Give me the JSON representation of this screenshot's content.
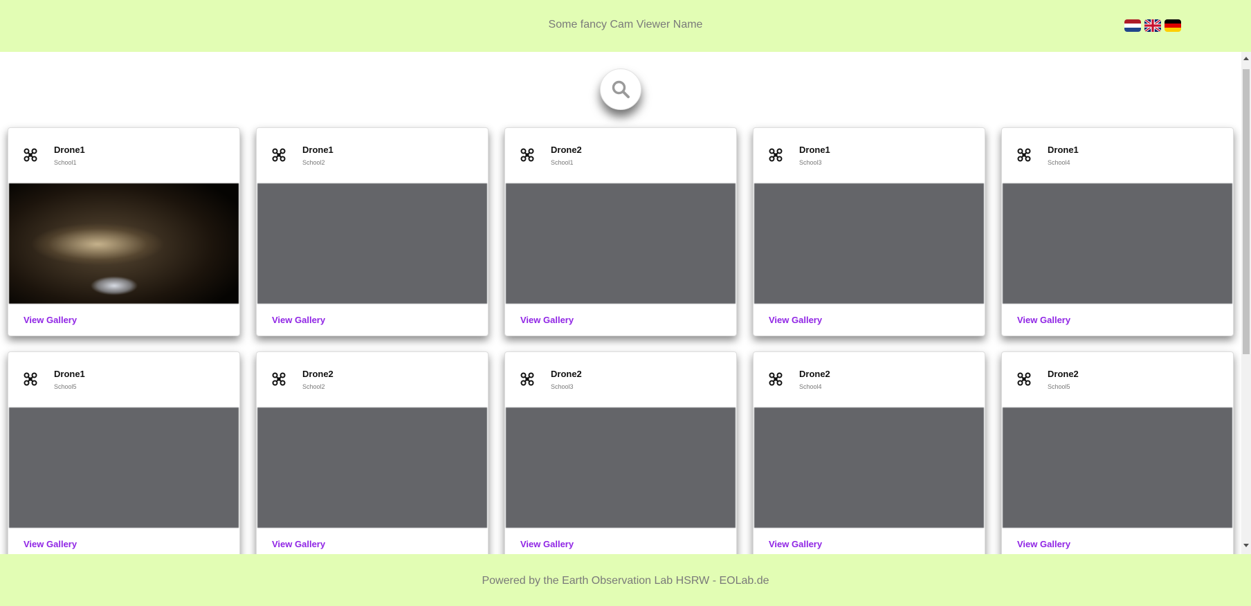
{
  "header": {
    "title": "Some fancy Cam Viewer Name",
    "flags": [
      {
        "icon": "netherlands-flag-icon"
      },
      {
        "icon": "uk-flag-icon"
      },
      {
        "icon": "germany-flag-icon"
      }
    ]
  },
  "search": {
    "icon": "search-icon"
  },
  "cards": [
    {
      "title": "Drone1",
      "subtitle": "School1",
      "link": "View Gallery",
      "has_image": true
    },
    {
      "title": "Drone1",
      "subtitle": "School2",
      "link": "View Gallery",
      "has_image": false
    },
    {
      "title": "Drone2",
      "subtitle": "School1",
      "link": "View Gallery",
      "has_image": false
    },
    {
      "title": "Drone1",
      "subtitle": "School3",
      "link": "View Gallery",
      "has_image": false
    },
    {
      "title": "Drone1",
      "subtitle": "School4",
      "link": "View Gallery",
      "has_image": false
    },
    {
      "title": "Drone1",
      "subtitle": "School5",
      "link": "View Gallery",
      "has_image": false
    },
    {
      "title": "Drone2",
      "subtitle": "School2",
      "link": "View Gallery",
      "has_image": false
    },
    {
      "title": "Drone2",
      "subtitle": "School3",
      "link": "View Gallery",
      "has_image": false
    },
    {
      "title": "Drone2",
      "subtitle": "School4",
      "link": "View Gallery",
      "has_image": false
    },
    {
      "title": "Drone2",
      "subtitle": "School5",
      "link": "View Gallery",
      "has_image": false
    }
  ],
  "footer": {
    "text": "Powered by the Earth Observation Lab HSRW - EOLab.de"
  },
  "colors": {
    "header_bg": "#e2fdb4",
    "link": "#9025e5",
    "placeholder": "#646569"
  }
}
